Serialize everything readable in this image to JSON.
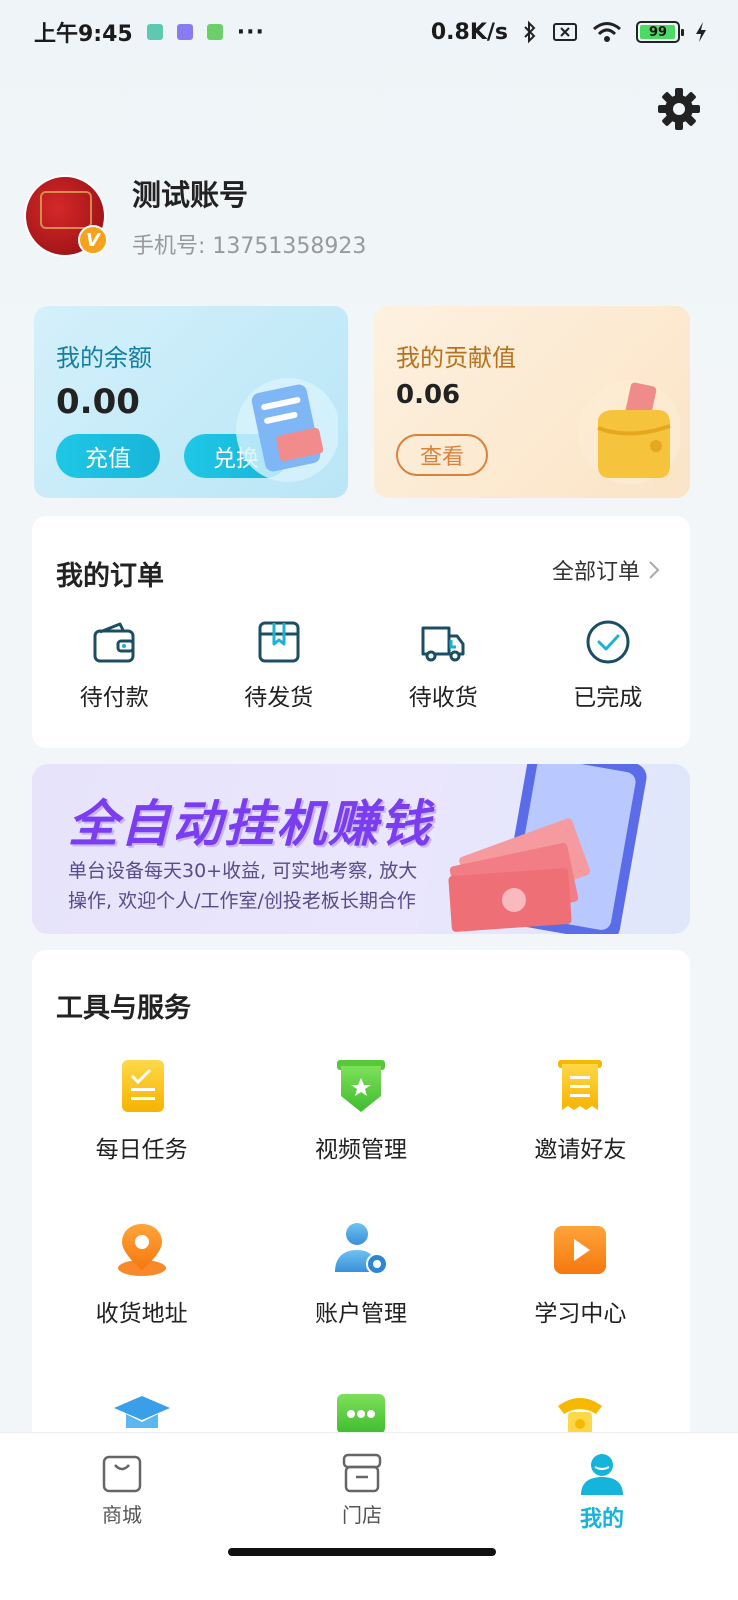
{
  "status_bar": {
    "time": "上午9:45",
    "dots": "···",
    "speed": "0.8K/s",
    "battery": "99"
  },
  "profile": {
    "name": "测试账号",
    "phone": "手机号: 13751358923",
    "badge": "V"
  },
  "balance_card": {
    "title": "我的余额",
    "value": "0.00",
    "recharge": "充值",
    "exchange": "兑换"
  },
  "contribution_card": {
    "title": "我的贡献值",
    "value": "0.06",
    "view": "查看"
  },
  "orders": {
    "title": "我的订单",
    "all": "全部订单",
    "items": [
      {
        "label": "待付款",
        "icon": "wallet-icon"
      },
      {
        "label": "待发货",
        "icon": "package-icon"
      },
      {
        "label": "待收货",
        "icon": "delivery-truck-icon"
      },
      {
        "label": "已完成",
        "icon": "check-circle-icon"
      }
    ]
  },
  "banner": {
    "title": "全自动挂机赚钱",
    "line1": "单台设备每天30+收益, 可实地考察, 放大",
    "line2": "操作, 欢迎个人/工作室/创投老板长期合作"
  },
  "tools": {
    "title": "工具与服务",
    "items": [
      {
        "label": "每日任务",
        "icon": "clipboard-icon"
      },
      {
        "label": "视频管理",
        "icon": "star-shield-icon"
      },
      {
        "label": "邀请好友",
        "icon": "receipt-icon"
      },
      {
        "label": "收货地址",
        "icon": "location-pin-icon"
      },
      {
        "label": "账户管理",
        "icon": "user-gear-icon"
      },
      {
        "label": "学习中心",
        "icon": "play-icon"
      }
    ]
  },
  "tabbar": {
    "shop": "商城",
    "store": "门店",
    "mine": "我的"
  },
  "colors": {
    "accent": "#15b5db",
    "contribution": "#d9823a",
    "banner_title": "#7a3df0"
  }
}
